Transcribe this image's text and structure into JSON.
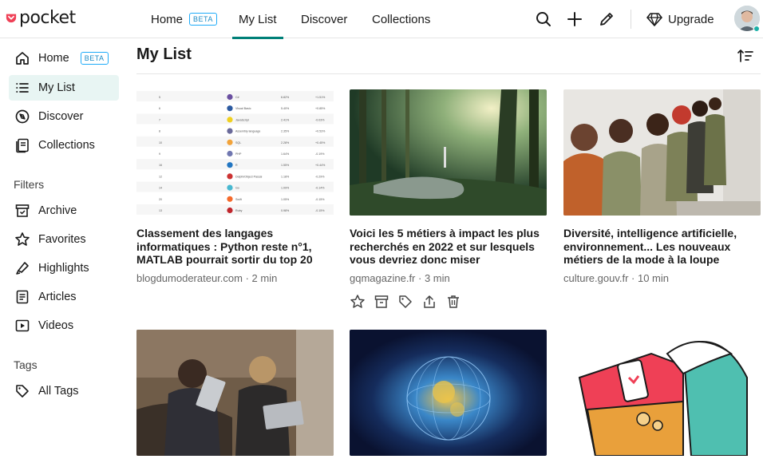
{
  "app": {
    "logo_text": "pocket"
  },
  "topnav": [
    {
      "label": "Home",
      "badge": "BETA"
    },
    {
      "label": "My List"
    },
    {
      "label": "Discover"
    },
    {
      "label": "Collections"
    }
  ],
  "header_actions": {
    "upgrade_label": "Upgrade"
  },
  "sidebar": {
    "items": [
      {
        "label": "Home",
        "badge": "BETA"
      },
      {
        "label": "My List"
      },
      {
        "label": "Discover"
      },
      {
        "label": "Collections"
      }
    ],
    "filters_heading": "Filters",
    "filters": [
      {
        "label": "Archive"
      },
      {
        "label": "Favorites"
      },
      {
        "label": "Highlights"
      },
      {
        "label": "Articles"
      },
      {
        "label": "Videos"
      }
    ],
    "tags_heading": "Tags",
    "tags": [
      {
        "label": "All Tags"
      }
    ]
  },
  "main": {
    "title": "My List"
  },
  "cards": [
    {
      "title": "Classement des langages informatiques : Python reste n°1, MATLAB pourrait sortir du top 20",
      "source": "blogdumoderateur.com",
      "time": "2 min",
      "image": {
        "rows": [
          {
            "rank": "5",
            "lang": "C#",
            "p": "6.82%",
            "c": "+1.51%"
          },
          {
            "rank": "6",
            "lang": "Visual Basic",
            "p": "5.40%",
            "c": "+0.85%"
          },
          {
            "rank": "7",
            "lang": "JavaScript",
            "p": "2.41%",
            "c": "-0.03%"
          },
          {
            "rank": "8",
            "lang": "Assembly language",
            "p": "2.35%",
            "c": "+0.53%"
          },
          {
            "rank": "10",
            "lang": "SQL",
            "p": "2.28%",
            "c": "+0.45%"
          },
          {
            "rank": "9",
            "lang": "PHP",
            "p": "1.64%",
            "c": "-0.19%"
          },
          {
            "rank": "16",
            "lang": "R",
            "p": "1.55%",
            "c": "+0.44%"
          },
          {
            "rank": "12",
            "lang": "Delphi/Object Pascal",
            "p": "1.18%",
            "c": "-0.29%"
          },
          {
            "rank": "14",
            "lang": "Go",
            "p": "1.09%",
            "c": "-0.14%"
          },
          {
            "rank": "20",
            "lang": "Swift",
            "p": "1.05%",
            "c": "-0.15%"
          },
          {
            "rank": "13",
            "lang": "Ruby",
            "p": "0.98%",
            "c": "-0.15%"
          }
        ]
      }
    },
    {
      "title": "Voici les 5 métiers à impact les plus recherchés en 2022 et sur lesquels vous devriez donc miser",
      "source": "gqmagazine.fr",
      "time": "3 min"
    },
    {
      "title": "Diversité, intelligence artificielle, environnement... Les nouveaux métiers de la mode à la loupe",
      "source": "culture.gouv.fr",
      "time": "10 min"
    },
    {
      "title": "",
      "source": "",
      "time": ""
    },
    {
      "title": "",
      "source": "",
      "time": ""
    },
    {
      "title": "",
      "source": "",
      "time": ""
    }
  ],
  "card_action_icons": [
    "star-icon",
    "archive-icon",
    "tag-icon",
    "share-icon",
    "trash-icon"
  ],
  "colors": {
    "accent": "#008078",
    "active_bg": "#e8f5f3",
    "logo_red": "#ef4056",
    "beta_blue": "#1eabf9"
  }
}
